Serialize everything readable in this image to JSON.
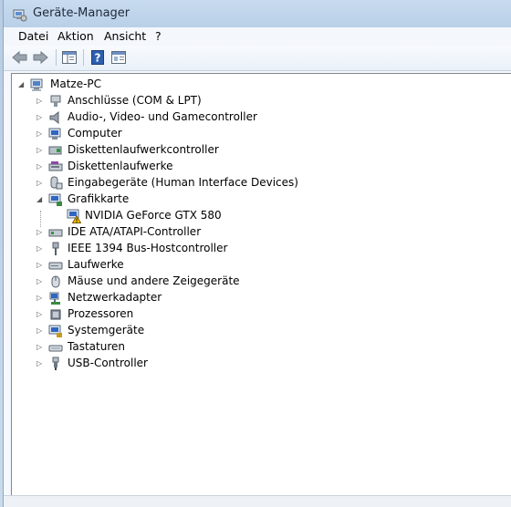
{
  "window": {
    "title": "Geräte-Manager"
  },
  "menu": [
    {
      "label": "Datei"
    },
    {
      "label": "Aktion"
    },
    {
      "label": "Ansicht"
    },
    {
      "label": "?"
    }
  ],
  "toolbar": {
    "buttons": [
      {
        "name": "back-button",
        "icon": "arrow-left-icon"
      },
      {
        "name": "forward-button",
        "icon": "arrow-right-icon"
      },
      {
        "name": "console-tree-button",
        "icon": "console-tree-icon"
      },
      {
        "name": "help-button",
        "icon": "help-icon"
      },
      {
        "name": "properties-button",
        "icon": "properties-icon"
      }
    ]
  },
  "tree": {
    "root": {
      "label": "Matze-PC",
      "expanded": true
    },
    "items": [
      {
        "label": "Anschlüsse (COM & LPT)",
        "icon": "port-icon",
        "expanded": false
      },
      {
        "label": "Audio-, Video- und Gamecontroller",
        "icon": "speaker-icon",
        "expanded": false
      },
      {
        "label": "Computer",
        "icon": "computer-icon",
        "expanded": false
      },
      {
        "label": "Diskettenlaufwerkcontroller",
        "icon": "floppy-controller-icon",
        "expanded": false
      },
      {
        "label": "Diskettenlaufwerke",
        "icon": "floppy-drive-icon",
        "expanded": false
      },
      {
        "label": "Eingabegeräte (Human Interface Devices)",
        "icon": "hid-icon",
        "expanded": false
      },
      {
        "label": "Grafikkarte",
        "icon": "display-adapter-icon",
        "expanded": true,
        "children": [
          {
            "label": "NVIDIA GeForce GTX 580",
            "icon": "display-warning-icon",
            "warning": true
          }
        ]
      },
      {
        "label": "IDE ATA/ATAPI-Controller",
        "icon": "ide-controller-icon",
        "expanded": false
      },
      {
        "label": "IEEE 1394 Bus-Hostcontroller",
        "icon": "firewire-icon",
        "expanded": false
      },
      {
        "label": "Laufwerke",
        "icon": "disk-drive-icon",
        "expanded": false
      },
      {
        "label": "Mäuse und andere Zeigegeräte",
        "icon": "mouse-icon",
        "expanded": false
      },
      {
        "label": "Netzwerkadapter",
        "icon": "network-adapter-icon",
        "expanded": false
      },
      {
        "label": "Prozessoren",
        "icon": "processor-icon",
        "expanded": false
      },
      {
        "label": "Systemgeräte",
        "icon": "system-device-icon",
        "expanded": false
      },
      {
        "label": "Tastaturen",
        "icon": "keyboard-icon",
        "expanded": false
      },
      {
        "label": "USB-Controller",
        "icon": "usb-icon",
        "expanded": false
      }
    ]
  },
  "colors": {
    "warning": "#f2c200",
    "titlebar": "#c8dbef",
    "accent": "#1f4fa0"
  }
}
